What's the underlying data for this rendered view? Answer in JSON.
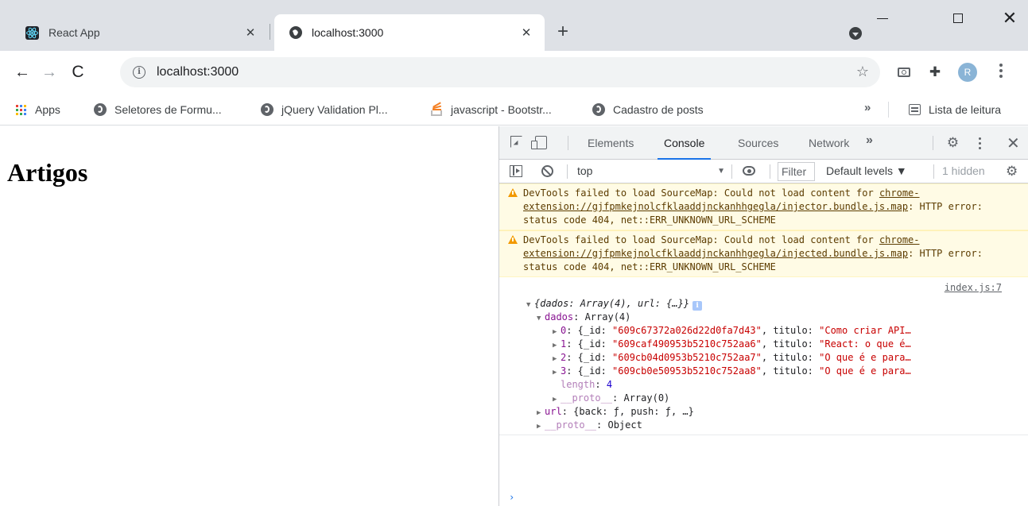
{
  "tabs": [
    {
      "title": "React App",
      "favicon": "react-icon",
      "active": false
    },
    {
      "title": "localhost:3000",
      "favicon": "globe-icon",
      "active": true
    }
  ],
  "toolbar": {
    "url": "localhost:3000",
    "avatar_letter": "R"
  },
  "bookmarks": {
    "items": [
      {
        "label": "Apps",
        "icon": "apps-grid-icon"
      },
      {
        "label": "Seletores de Formu...",
        "icon": "globe-icon"
      },
      {
        "label": "jQuery Validation Pl...",
        "icon": "globe-icon"
      },
      {
        "label": "javascript - Bootstr...",
        "icon": "stackoverflow-icon"
      },
      {
        "label": "Cadastro de posts",
        "icon": "globe-icon"
      }
    ],
    "more": "»",
    "reading_list": "Lista de leitura"
  },
  "page": {
    "heading": "Artigos"
  },
  "devtools": {
    "tabs": [
      "Elements",
      "Console",
      "Sources",
      "Network"
    ],
    "active_tab": "Console",
    "more": "»",
    "context": "top",
    "filter_placeholder": "Filter",
    "levels": "Default levels ▼",
    "hidden": "1 hidden",
    "warnings": [
      {
        "prefix": "DevTools failed to load SourceMap: Could not load content for ",
        "link": "chrome-extension://gjfpmkejnolcfklaaddjnckanhhgegla/injector.bundle.js.map",
        "suffix": ": HTTP error: status code 404, net::ERR_UNKNOWN_URL_SCHEME"
      },
      {
        "prefix": "DevTools failed to load SourceMap: Could not load content for ",
        "link": "chrome-extension://gjfpmkejnolcfklaaddjnckanhhgegla/injected.bundle.js.map",
        "suffix": ": HTTP error: status code 404, net::ERR_UNKNOWN_URL_SCHEME"
      }
    ],
    "log": {
      "source": "index.js:7",
      "summary": "{dados: Array(4), url: {…}}",
      "dados_key": "dados",
      "dados_type": "Array(4)",
      "items": [
        {
          "index": "0",
          "id": "\"609c67372a026d22d0fa7d43\"",
          "titulo": "\"Como criar API…"
        },
        {
          "index": "1",
          "id": "\"609caf490953b5210c752aa6\"",
          "titulo": "\"React: o que é…"
        },
        {
          "index": "2",
          "id": "\"609cb04d0953b5210c752aa7\"",
          "titulo": "\"O que é e para…"
        },
        {
          "index": "3",
          "id": "\"609cb0e50953b5210c752aa8\"",
          "titulo": "\"O que é e para…"
        }
      ],
      "length_key": "length",
      "length_value": "4",
      "array_proto_key": "__proto__",
      "array_proto_value": "Array(0)",
      "url_key": "url",
      "url_value": "{back: ƒ, push: ƒ, …}",
      "obj_proto_key": "__proto__",
      "obj_proto_value": "Object"
    },
    "prompt": "›"
  },
  "colors": {
    "tabstrip": "#dee1e6",
    "accent": "#1a73e8",
    "warning_bg": "#fffbe5",
    "string": "#c80000",
    "key": "#881391",
    "number": "#1c00cf"
  }
}
